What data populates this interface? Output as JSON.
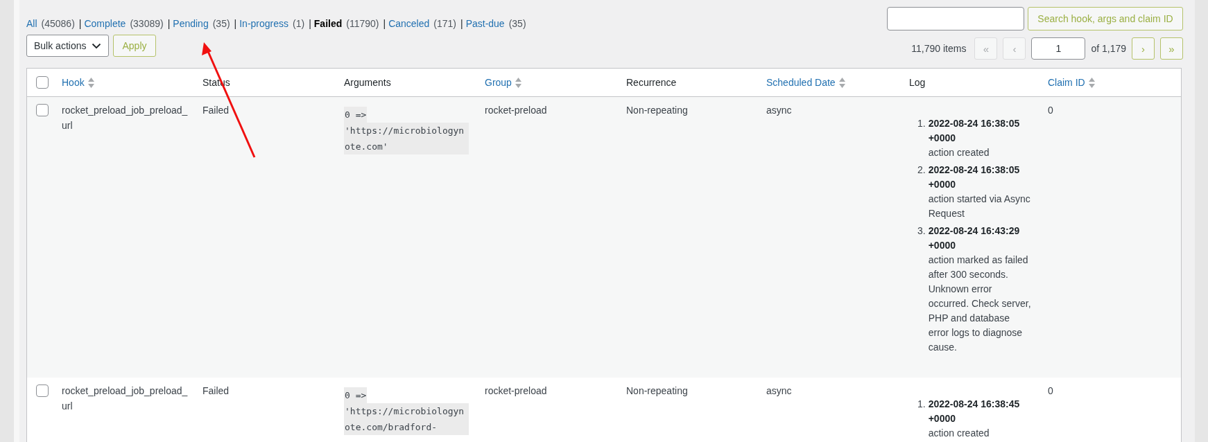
{
  "filters": [
    {
      "label": "All",
      "count": "(45086)",
      "selected": false,
      "separator": "|"
    },
    {
      "label": "Complete",
      "count": "(33089)",
      "selected": false,
      "separator": "|"
    },
    {
      "label": "Pending",
      "count": "(35)",
      "selected": false,
      "separator": "|"
    },
    {
      "label": "In-progress",
      "count": "(1)",
      "selected": false,
      "separator": "|"
    },
    {
      "label": "Failed",
      "count": "(11790)",
      "selected": true,
      "separator": "|"
    },
    {
      "label": "Canceled",
      "count": "(171)",
      "selected": false,
      "separator": "|"
    },
    {
      "label": "Past-due",
      "count": "(35)",
      "selected": false
    }
  ],
  "bulk_actions": {
    "label": "Bulk actions"
  },
  "apply_button": "Apply",
  "search_button": "Search hook, args and claim ID",
  "pagination": {
    "items": "11,790 items",
    "page": "1",
    "of": "of 1,179",
    "buttons_before": [
      {
        "label": "«",
        "disabled": true
      },
      {
        "label": "‹",
        "disabled": true
      }
    ],
    "buttons_after": [
      {
        "label": "›",
        "disabled": false
      },
      {
        "label": "»",
        "disabled": false
      }
    ]
  },
  "table": {
    "select_all_checked": false,
    "columns": [
      {
        "label": "Hook",
        "sortable": true
      },
      {
        "label": "Status",
        "sortable": false
      },
      {
        "label": "Arguments",
        "sortable": false
      },
      {
        "label": "Group",
        "sortable": true
      },
      {
        "label": "Recurrence",
        "sortable": false
      },
      {
        "label": "Scheduled Date",
        "sortable": true
      },
      {
        "label": "Log",
        "sortable": false
      },
      {
        "label": "Claim ID",
        "sortable": true
      }
    ],
    "rows": [
      {
        "checked": false,
        "hook": "rocket_preload_job_preload_url",
        "status": "Failed",
        "arguments": [
          "0 =>",
          "'https://microbiologynote.com'"
        ],
        "group": "rocket-preload",
        "recurrence": "Non-repeating",
        "scheduled": "async",
        "claim_id": "0",
        "log": [
          {
            "index": "1.",
            "date": "2022-08-24 16:38:05 +0000",
            "message": "action created"
          },
          {
            "index": "2.",
            "date": "2022-08-24 16:38:05 +0000",
            "message": "action started via Async Request"
          },
          {
            "index": "3.",
            "date": "2022-08-24 16:43:29 +0000",
            "message": "action marked as failed after 300 seconds. Unknown error occurred. Check server, PHP and database error logs to diagnose cause."
          }
        ]
      },
      {
        "checked": false,
        "hook": "rocket_preload_job_preload_url",
        "status": "Failed",
        "arguments": [
          "0 =>",
          "'https://microbiologynote.com/bradford-"
        ],
        "group": "rocket-preload",
        "recurrence": "Non-repeating",
        "scheduled": "async",
        "claim_id": "0",
        "log": [
          {
            "index": "1.",
            "date": "2022-08-24 16:38:45 +0000",
            "message": "action created"
          }
        ]
      }
    ]
  }
}
